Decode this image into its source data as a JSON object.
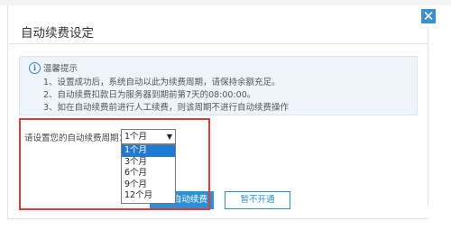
{
  "dialog": {
    "title": "自动续费设定",
    "close_glyph": "✕"
  },
  "tips": {
    "icon_glyph": "i",
    "title": "温馨提示",
    "lines": [
      "1、设置成功后，系统自动以此为续费周期，请保持余额充足。",
      "2、自动续费扣款日为服务器到期前第7天的08:00:00。",
      "3、如在自动续费前进行人工续费，则该周期不进行自动续费操作"
    ]
  },
  "period": {
    "label": "请设置您的自动续费周期：",
    "selected": "1个月",
    "arrow": "▼",
    "options": [
      "1个月",
      "3个月",
      "6个月",
      "9个月",
      "12个月"
    ],
    "highlighted_index": 0
  },
  "buttons": {
    "primary_label": "开通自动续费",
    "secondary_label": "暂不开通"
  },
  "colors": {
    "accent": "#2d8fd4",
    "highlight_frame": "#e03b3b",
    "tip_background": "#edf4fa"
  }
}
